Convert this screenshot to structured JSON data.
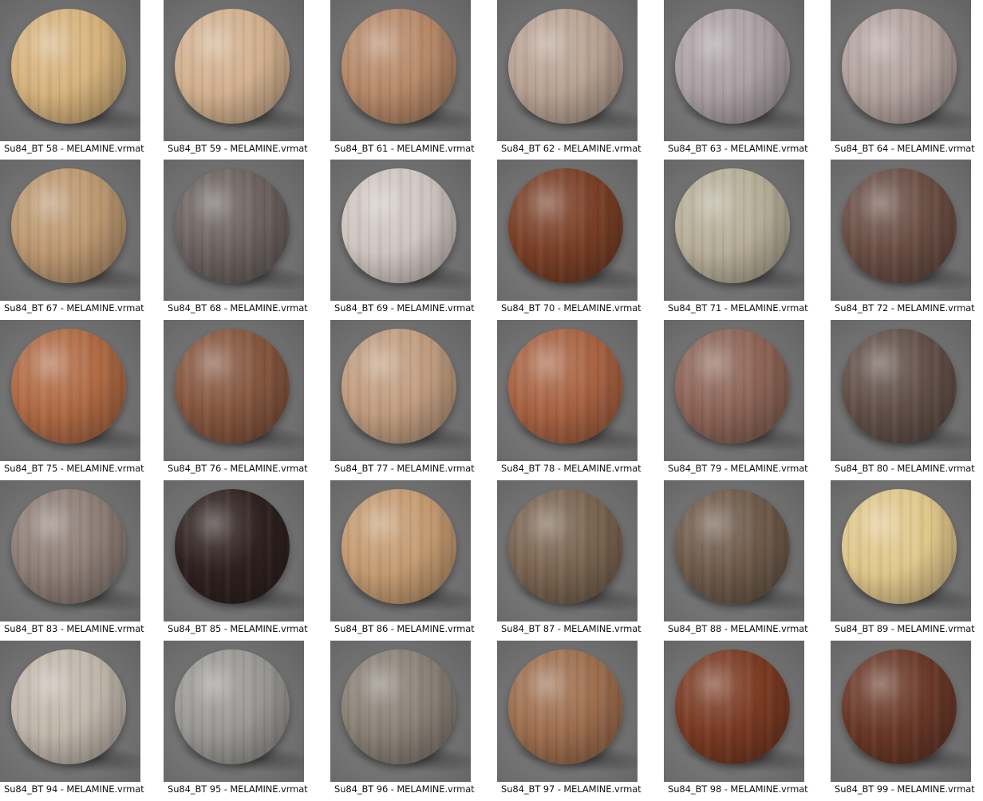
{
  "materials": [
    {
      "label": "Su84_BT 58 - MELAMINE.vrmat",
      "color": "#d6b27c"
    },
    {
      "label": "Su84_BT 59 - MELAMINE.vrmat",
      "color": "#d2b08e"
    },
    {
      "label": "Su84_BT 61 - MELAMINE.vrmat",
      "color": "#b68868"
    },
    {
      "label": "Su84_BT 62 - MELAMINE.vrmat",
      "color": "#b8a292"
    },
    {
      "label": "Su84_BT 63 - MELAMINE.vrmat",
      "color": "#aba0a4"
    },
    {
      "label": "Su84_BT 64 - MELAMINE.vrmat",
      "color": "#b2a29e"
    },
    {
      "label": "Su84_BT 67 - MELAMINE.vrmat",
      "color": "#bc9870"
    },
    {
      "label": "Su84_BT 68 - MELAMINE.vrmat",
      "color": "#6c625f"
    },
    {
      "label": "Su84_BT 69 - MELAMINE.vrmat",
      "color": "#cfc5c0"
    },
    {
      "label": "Su84_BT 70 - MELAMINE.vrmat",
      "color": "#7a3f26"
    },
    {
      "label": "Su84_BT 71 - MELAMINE.vrmat",
      "color": "#b6ae98"
    },
    {
      "label": "Su84_BT 72 - MELAMINE.vrmat",
      "color": "#6a4e44"
    },
    {
      "label": "Su84_BT 75 - MELAMINE.vrmat",
      "color": "#b06a44"
    },
    {
      "label": "Su84_BT 76 - MELAMINE.vrmat",
      "color": "#85563e"
    },
    {
      "label": "Su84_BT 77 - MELAMINE.vrmat",
      "color": "#c09c7e"
    },
    {
      "label": "Su84_BT 78 - MELAMINE.vrmat",
      "color": "#a86242"
    },
    {
      "label": "Su84_BT 79 - MELAMINE.vrmat",
      "color": "#8c6456"
    },
    {
      "label": "Su84_BT 80 - MELAMINE.vrmat",
      "color": "#625048"
    },
    {
      "label": "Su84_BT 83 - MELAMINE.vrmat",
      "color": "#8e7e76"
    },
    {
      "label": "Su84_BT 85 - MELAMINE.vrmat",
      "color": "#2e211f"
    },
    {
      "label": "Su84_BT 86 - MELAMINE.vrmat",
      "color": "#c49a70"
    },
    {
      "label": "Su84_BT 87 - MELAMINE.vrmat",
      "color": "#7a6450"
    },
    {
      "label": "Su84_BT 88 - MELAMINE.vrmat",
      "color": "#6e5a4a"
    },
    {
      "label": "Su84_BT 89 - MELAMINE.vrmat",
      "color": "#e0c68a"
    },
    {
      "label": "Su84_BT 94 - MELAMINE.vrmat",
      "color": "#c0b6aa"
    },
    {
      "label": "Su84_BT 95 - MELAMINE.vrmat",
      "color": "#9a9894"
    },
    {
      "label": "Su84_BT 96 - MELAMINE.vrmat",
      "color": "#8a8076"
    },
    {
      "label": "Su84_BT 97 - MELAMINE.vrmat",
      "color": "#9e6e4e"
    },
    {
      "label": "Su84_BT 98 - MELAMINE.vrmat",
      "color": "#7a3a22"
    },
    {
      "label": "Su84_BT 99 - MELAMINE.vrmat",
      "color": "#6a3828"
    }
  ]
}
